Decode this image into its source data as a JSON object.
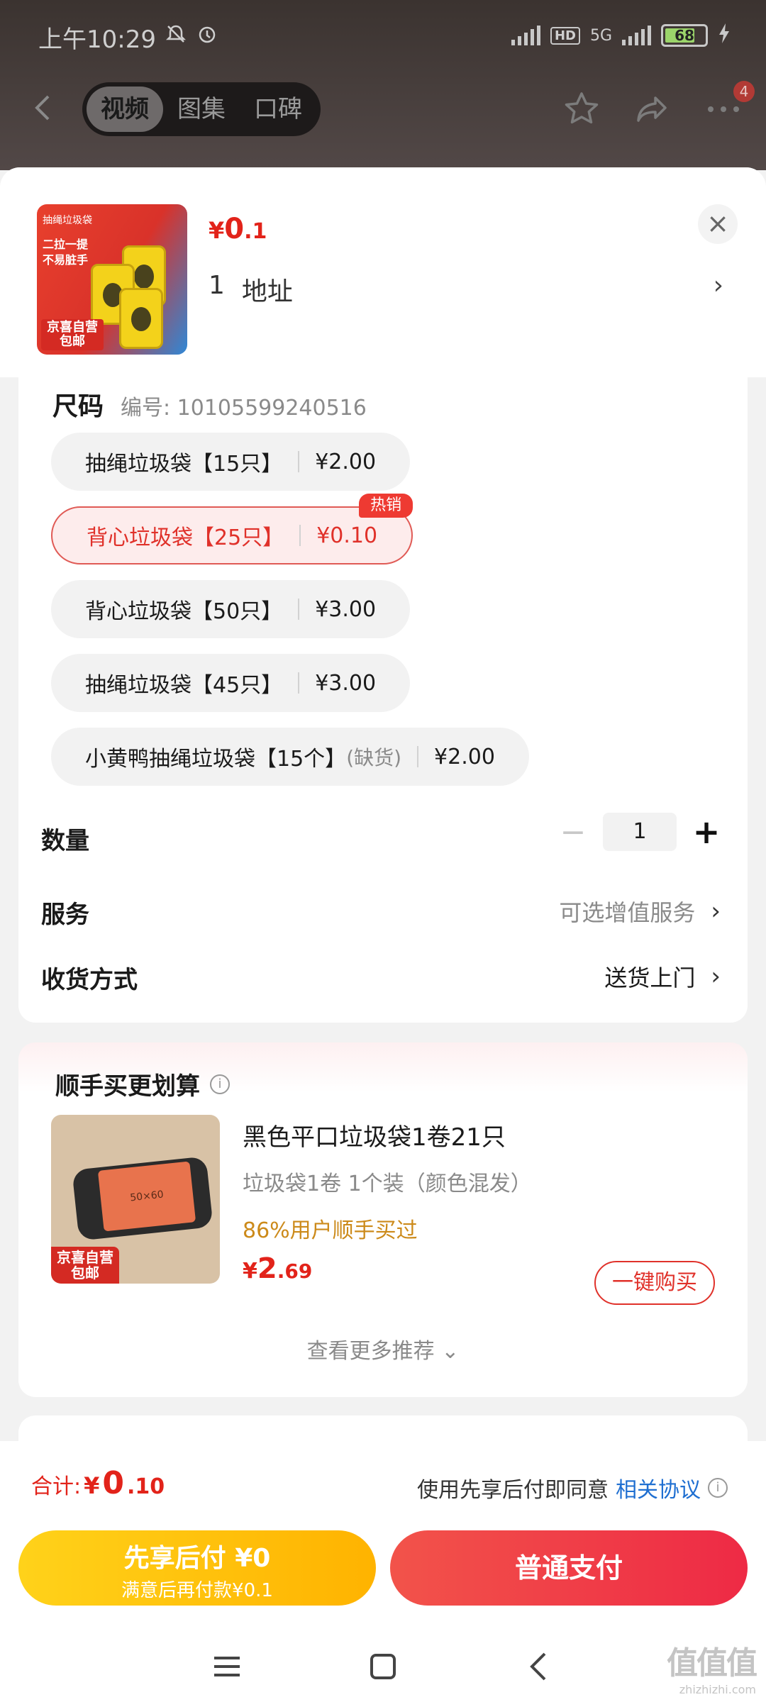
{
  "status_bar": {
    "time": "上午10:29",
    "network_label": "HD",
    "network_type": "5G",
    "battery": "68"
  },
  "nav": {
    "tabs": [
      "视频",
      "图集",
      "口碑"
    ],
    "active_tab": 0,
    "notification_count": "4"
  },
  "product": {
    "thumb_tag": "抽绳垃圾袋",
    "thumb_text": "二拉一提\n不易脏手",
    "thumb_ship": "包邮",
    "price_symbol": "¥",
    "price_int": "0",
    "price_dec": ".1",
    "address_count": "1",
    "address_label": "地址"
  },
  "spec": {
    "title": "尺码",
    "code": "编号: 10105599240516",
    "options": [
      {
        "name": "抽绳垃圾袋【15只】",
        "price": "¥2.00",
        "status": "",
        "selected": false
      },
      {
        "name": "背心垃圾袋【25只】",
        "price": "¥0.10",
        "status": "",
        "selected": true,
        "tag": "热销"
      },
      {
        "name": "背心垃圾袋【50只】",
        "price": "¥3.00",
        "status": "",
        "selected": false
      },
      {
        "name": "抽绳垃圾袋【45只】",
        "price": "¥3.00",
        "status": "",
        "selected": false
      },
      {
        "name": "小黄鸭抽绳垃圾袋【15个】",
        "price": "¥2.00",
        "status": "(缺货)",
        "selected": false
      }
    ]
  },
  "quantity": {
    "label": "数量",
    "value": "1",
    "minus": "−",
    "plus": "+"
  },
  "service": {
    "label": "服务",
    "value": "可选增值服务"
  },
  "delivery": {
    "label": "收货方式",
    "value": "送货上门"
  },
  "reco": {
    "title": "顺手买更划算",
    "item": {
      "name": "黑色平口垃圾袋1卷21只",
      "spec": "垃圾袋1卷   1个装（颜色混发）",
      "buyers": "86%用户顺手买过",
      "price_symbol": "¥",
      "price_int": "2",
      "price_dec": ".69",
      "ship_tag": "包邮",
      "buy_label": "一键购买"
    },
    "more_label": "查看更多推荐"
  },
  "bottom": {
    "total_label": "合计:",
    "total_symbol": "¥",
    "total_int": "0",
    "total_dec": ".10",
    "agree_prefix": "使用先享后付即同意",
    "agree_link": "相关协议",
    "later_main": "先享后付 ¥0",
    "later_sub": "满意后再付款¥0.1",
    "pay_label": "普通支付"
  },
  "watermark": {
    "main": "值值值",
    "sub": "zhizhizhi.com"
  },
  "colors": {
    "accent_red": "#e2231a",
    "later_yellow": "#ffb300",
    "link_blue": "#1f6fd1",
    "buyers_orange": "#cc8a1a"
  }
}
